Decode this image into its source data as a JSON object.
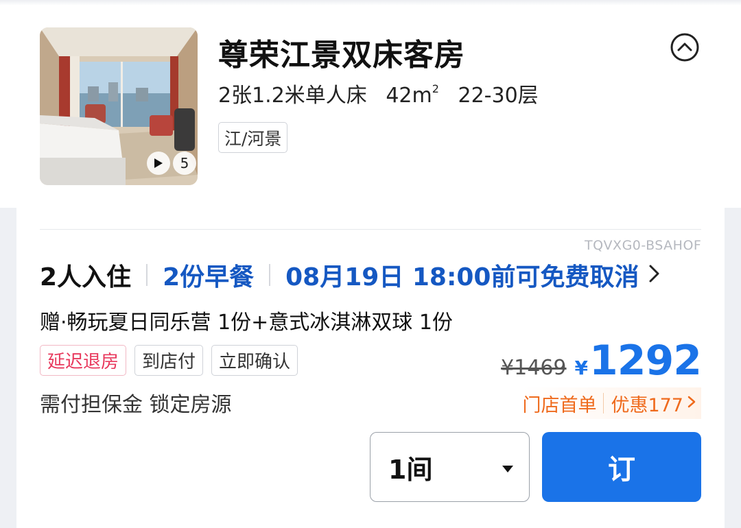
{
  "room": {
    "title": "尊荣江景双床客房",
    "bed": "2张1.2米单人床",
    "area": "42m",
    "area_sup": "2",
    "floors": "22-30层",
    "view_tag": "江/河景",
    "media_count": "5"
  },
  "offer": {
    "code": "TQVXG0-BSAHOF",
    "occupancy": "2人入住",
    "breakfast": "2份早餐",
    "cancellation": "08月19日 18:00前可免费取消",
    "gift": "赠·畅玩夏日同乐营 1份+意式冰淇淋双球 1份",
    "tags": [
      "延迟退房",
      "到店付",
      "立即确认"
    ],
    "deposit_note": "需付担保金 锁定房源",
    "original_price": "¥1469",
    "currency_symbol": "¥",
    "price": "1292",
    "promo_label": "门店首单",
    "promo_discount": "优惠177",
    "quantity": "1间",
    "book_label": "订"
  },
  "colors": {
    "brand_blue": "#1a73e8",
    "link_blue": "#1558c2",
    "promo_orange": "#ef6a1c",
    "tag_red": "#e8385c"
  },
  "icons": [
    "play-icon",
    "collapse-up-icon",
    "chevron-right-icon",
    "dropdown-caret-icon"
  ]
}
